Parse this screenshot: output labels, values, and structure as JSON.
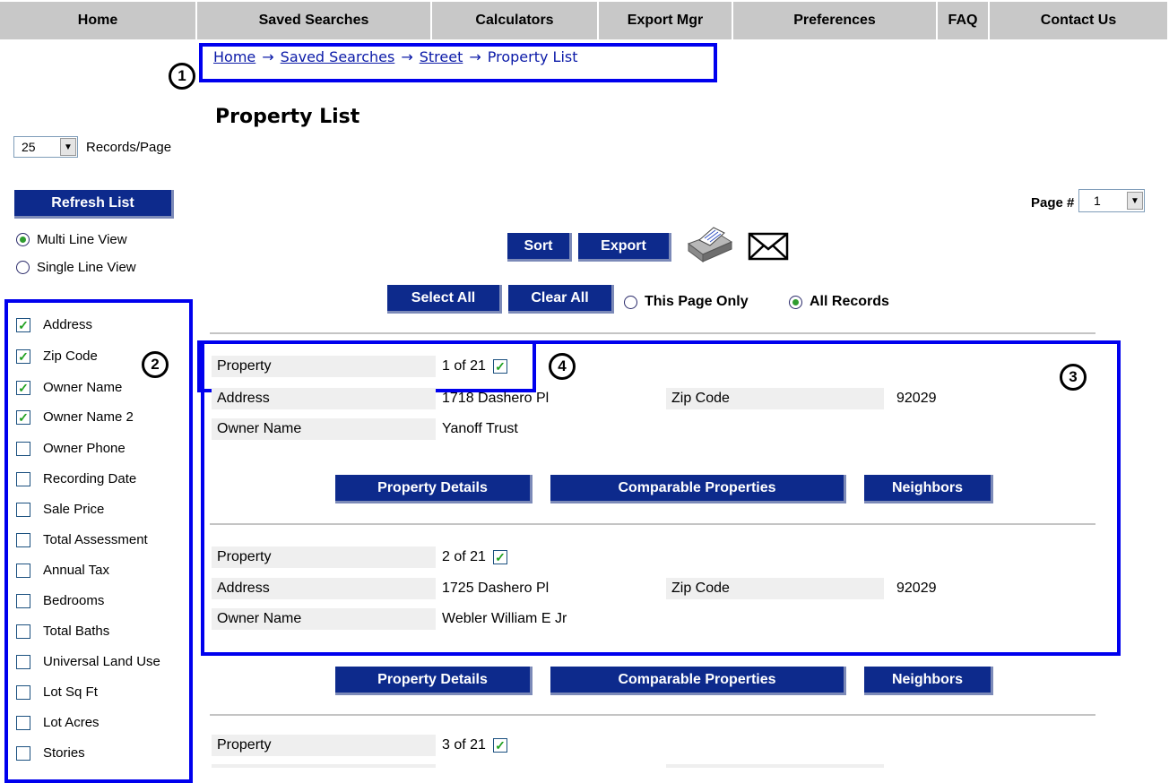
{
  "nav": {
    "items": [
      {
        "label": "Home"
      },
      {
        "label": "Saved Searches"
      },
      {
        "label": "Calculators"
      },
      {
        "label": "Export Mgr"
      },
      {
        "label": "Preferences"
      },
      {
        "label": "FAQ"
      },
      {
        "label": "Contact Us"
      }
    ]
  },
  "breadcrumb": {
    "items": [
      {
        "label": "Home"
      },
      {
        "label": "Saved Searches"
      },
      {
        "label": "Street"
      },
      {
        "label": "Property List"
      }
    ],
    "separator": "→"
  },
  "callouts": [
    "1",
    "2",
    "3",
    "4"
  ],
  "page_title": "Property List",
  "sidebar": {
    "records_per_page_value": "25",
    "records_per_page_label": "Records/Page",
    "refresh_label": "Refresh List",
    "view_options": [
      {
        "label": "Multi Line View",
        "selected": true
      },
      {
        "label": "Single Line View",
        "selected": false
      }
    ],
    "fields": [
      {
        "label": "Address",
        "checked": true
      },
      {
        "label": "Zip Code",
        "checked": true
      },
      {
        "label": "Owner Name",
        "checked": true
      },
      {
        "label": "Owner Name 2",
        "checked": true
      },
      {
        "label": "Owner Phone",
        "checked": false
      },
      {
        "label": "Recording Date",
        "checked": false
      },
      {
        "label": "Sale Price",
        "checked": false
      },
      {
        "label": "Total Assessment",
        "checked": false
      },
      {
        "label": "Annual Tax",
        "checked": false
      },
      {
        "label": "Bedrooms",
        "checked": false
      },
      {
        "label": "Total Baths",
        "checked": false
      },
      {
        "label": "Universal Land Use",
        "checked": false
      },
      {
        "label": "Lot Sq Ft",
        "checked": false
      },
      {
        "label": "Lot Acres",
        "checked": false
      },
      {
        "label": "Stories",
        "checked": false
      }
    ]
  },
  "pager": {
    "label": "Page #",
    "value": "1"
  },
  "toolbar": {
    "sort_label": "Sort",
    "export_label": "Export",
    "select_all_label": "Select All",
    "clear_all_label": "Clear All",
    "scope_options": [
      {
        "label": "This Page Only",
        "selected": false
      },
      {
        "label": "All Records",
        "selected": true
      }
    ]
  },
  "labels": {
    "property": "Property",
    "address": "Address",
    "zip_code": "Zip Code",
    "owner_name": "Owner Name"
  },
  "actions": {
    "details": "Property Details",
    "comparable": "Comparable Properties",
    "neighbors": "Neighbors"
  },
  "records": [
    {
      "index": "1 of 21",
      "checked": true,
      "address": "1718 Dashero Pl",
      "zip": "92029",
      "owner": "Yanoff Trust"
    },
    {
      "index": "2 of 21",
      "checked": true,
      "address": "1725 Dashero Pl",
      "zip": "92029",
      "owner": "Webler William E Jr"
    },
    {
      "index": "3 of 21",
      "checked": true
    }
  ],
  "colors": {
    "nav_bg": "#c8c8c8",
    "button_bg": "#0d2a8c",
    "callout_blue": "#0000ee",
    "link": "#0b1aa8"
  }
}
